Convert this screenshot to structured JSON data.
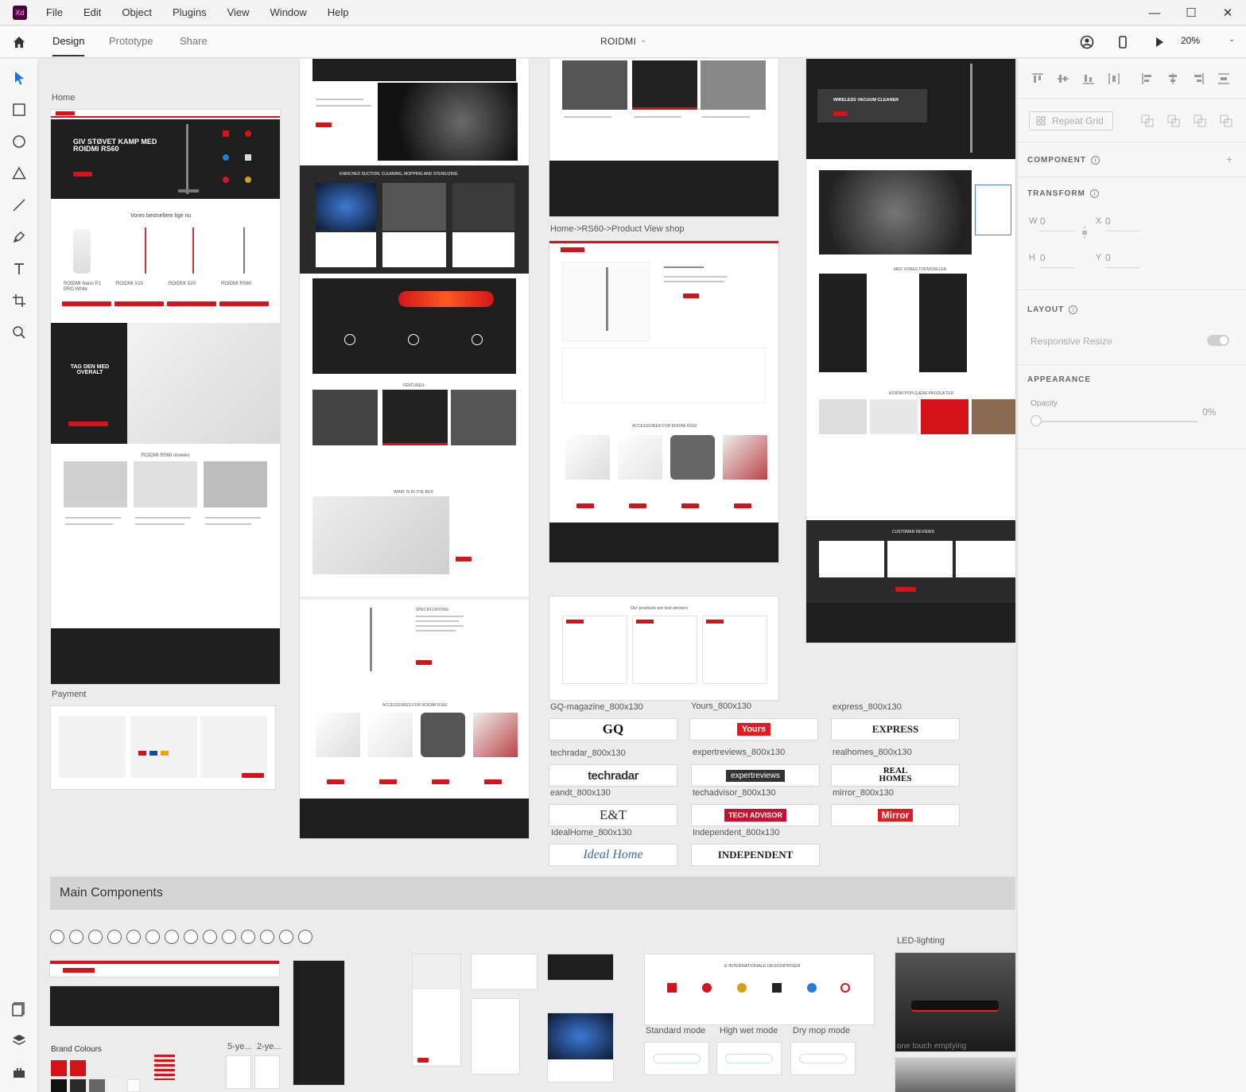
{
  "app": {
    "logo": "Xd"
  },
  "menu": [
    "File",
    "Edit",
    "Object",
    "Plugins",
    "View",
    "Window",
    "Help"
  ],
  "window_controls": {
    "minimize": "—",
    "maximize": "☐",
    "close": "✕"
  },
  "topbar": {
    "tabs": [
      "Design",
      "Prototype",
      "Share"
    ],
    "active_tab": "Design",
    "document_title": "ROIDMI",
    "zoom": "20%"
  },
  "canvas": {
    "artboard_labels": {
      "home": "Home",
      "product_view": "Home->RS60->Product View shop",
      "payment": "Payment",
      "led": "LED-lighting",
      "brand_colours": "Brand Colours"
    },
    "home": {
      "hero_title": "GIV STØVET KAMP MED ROIDMI RS60",
      "bestsellers": "Vores bestsellere lige nu",
      "products": [
        "ROIDMI Nano P1 PRO White",
        "ROIDMI X10",
        "ROIDMI X20",
        "ROIDMI RS60"
      ],
      "promo_title": "TAG DEN MED OVERALT",
      "reviews_title": "ROIDMI RS60 reviews"
    },
    "middle": {
      "section1": "ENRICHED SUCTION, CLEANING, MOPPING AND STERILIZING",
      "features": "FEATURES",
      "in_the_box": "WHAT IS IN THE BOX",
      "specifications": "SPECIFICATIONS",
      "accessories": "ACCESSORIES FOR ROIDMI RS60"
    },
    "product_view": {
      "accessories": "ACCESSORIES FOR ROIDMI RS60"
    },
    "test_winners": "Our products are test winners",
    "right_column": {
      "hero": "WIRELESS VACUUM CLEANER",
      "top_models": "MED VORES TOPMODELER",
      "popular": "ROIDMI POPULÆRE PRODUKTER",
      "customer_reviews": "CUSTOMER REVIEWS"
    },
    "logos": [
      {
        "label": "GQ-magazine_800x130",
        "text": "GQ"
      },
      {
        "label": "Yours_800x130",
        "text": "Yours"
      },
      {
        "label": "express_800x130",
        "text": "EXPRESS"
      },
      {
        "label": "techradar_800x130",
        "text": "techradar"
      },
      {
        "label": "expertreviews_800x130",
        "text": "expertreviews"
      },
      {
        "label": "realhomes_800x130",
        "text": "REAL HOMES"
      },
      {
        "label": "eandt_800x130",
        "text": "E&T"
      },
      {
        "label": "techadvisor_800x130",
        "text": "TECH ADVISOR"
      },
      {
        "label": "mirror_800x130",
        "text": "Mirror"
      },
      {
        "label": "IdealHome_800x130",
        "text": "Ideal Home"
      },
      {
        "label": "Independent_800x130",
        "text": "INDEPENDENT"
      }
    ],
    "main_components": "Main Components",
    "design_awards": "E INTERNATIONALE DESIGNPRISER",
    "modes": [
      "Standard mode",
      "High wet mode",
      "Dry mop mode"
    ],
    "warranty": [
      "5-ye...",
      "2-ye..."
    ],
    "led_caption": "one touch emptying"
  },
  "panel": {
    "repeat_grid": "Repeat Grid",
    "component": "COMPONENT",
    "transform": "TRANSFORM",
    "w_label": "W",
    "w": "0",
    "x_label": "X",
    "x": "0",
    "h_label": "H",
    "h": "0",
    "y_label": "Y",
    "y": "0",
    "layout": "LAYOUT",
    "responsive_resize": "Responsive Resize",
    "appearance": "APPEARANCE",
    "opacity_label": "Opacity",
    "opacity": "0%"
  },
  "colors": {
    "brand_red": "#d4141b",
    "dark": "#222222",
    "xd_purple": "#470137"
  }
}
